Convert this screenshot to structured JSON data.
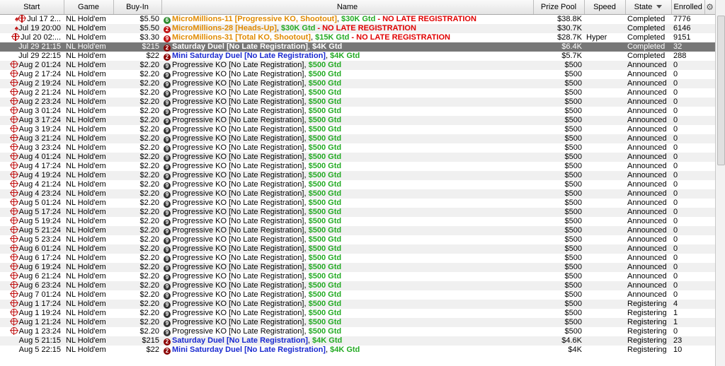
{
  "columns": {
    "start": "Start",
    "game": "Game",
    "buyin": "Buy-In",
    "name": "Name",
    "prize": "Prize Pool",
    "speed": "Speed",
    "state": "State",
    "enrolled": "Enrolled"
  },
  "rows": [
    {
      "icons": "spade-ko",
      "start": "Jul 17  2...",
      "game": "NL Hold'em",
      "buyin": "$5.50",
      "badge": "6",
      "badge_color": "green",
      "name": "MicroMillions-11 [Progressive KO, Shootout]",
      "name_style": "mm",
      "gtd": "$30K Gtd",
      "suffix": " - NO LATE REGISTRATION",
      "prize": "$38.8K",
      "speed": "",
      "state": "Completed",
      "enrolled": "7776"
    },
    {
      "icons": "spade",
      "start": "Jul 19  20:00",
      "game": "NL Hold'em",
      "buyin": "$5.50",
      "badge": "2",
      "badge_color": "red",
      "name": "MicroMillions-28 [Heads-Up]",
      "name_style": "mm",
      "gtd": "$30K Gtd",
      "suffix": " - NO LATE REGISTRATION",
      "prize": "$30.7K",
      "speed": "",
      "state": "Completed",
      "enrolled": "6146"
    },
    {
      "icons": "ko",
      "start": "Jul 20  02:...",
      "game": "NL Hold'em",
      "buyin": "$3.30",
      "badge": "9",
      "badge_color": "red",
      "name": "MicroMillions-31 [Total KO, Shootout]",
      "name_style": "mm",
      "gtd": "$15K Gtd",
      "suffix": " - NO LATE REGISTRATION",
      "prize": "$28.7K",
      "speed": "Hyper",
      "state": "Completed",
      "enrolled": "9151"
    },
    {
      "icons": "",
      "start": "Jul 29  21:15",
      "game": "NL Hold'em",
      "buyin": "$215",
      "badge": "2",
      "badge_color": "darkred",
      "name": "Saturday Duel [No Late Registration]",
      "name_style": "mini",
      "gtd": "$4K Gtd",
      "suffix": "",
      "prize": "$6.4K",
      "speed": "",
      "state": "Completed",
      "enrolled": "32",
      "selected": true
    },
    {
      "icons": "",
      "start": "Jul 29  22:15",
      "game": "NL Hold'em",
      "buyin": "$22",
      "badge": "2",
      "badge_color": "darkred",
      "name": "Mini Saturday Duel [No Late Registration]",
      "name_style": "mini",
      "gtd": "$4K Gtd",
      "suffix": "",
      "prize": "$5.7K",
      "speed": "",
      "state": "Completed",
      "enrolled": "288"
    },
    {
      "icons": "ko",
      "start": "Aug 2  01:24",
      "game": "NL Hold'em",
      "buyin": "$2.20",
      "badge": "9",
      "badge_color": "dark",
      "name": "Progressive KO [No Late Registration]",
      "name_style": "plain",
      "gtd": "$500 Gtd",
      "suffix": "",
      "prize": "$500",
      "speed": "",
      "state": "Announced",
      "enrolled": "0"
    },
    {
      "icons": "ko",
      "start": "Aug 2  17:24",
      "game": "NL Hold'em",
      "buyin": "$2.20",
      "badge": "9",
      "badge_color": "dark",
      "name": "Progressive KO [No Late Registration]",
      "name_style": "plain",
      "gtd": "$500 Gtd",
      "suffix": "",
      "prize": "$500",
      "speed": "",
      "state": "Announced",
      "enrolled": "0"
    },
    {
      "icons": "ko",
      "start": "Aug 2  19:24",
      "game": "NL Hold'em",
      "buyin": "$2.20",
      "badge": "9",
      "badge_color": "dark",
      "name": "Progressive KO [No Late Registration]",
      "name_style": "plain",
      "gtd": "$500 Gtd",
      "suffix": "",
      "prize": "$500",
      "speed": "",
      "state": "Announced",
      "enrolled": "0"
    },
    {
      "icons": "ko",
      "start": "Aug 2  21:24",
      "game": "NL Hold'em",
      "buyin": "$2.20",
      "badge": "9",
      "badge_color": "dark",
      "name": "Progressive KO [No Late Registration]",
      "name_style": "plain",
      "gtd": "$500 Gtd",
      "suffix": "",
      "prize": "$500",
      "speed": "",
      "state": "Announced",
      "enrolled": "0"
    },
    {
      "icons": "ko",
      "start": "Aug 2  23:24",
      "game": "NL Hold'em",
      "buyin": "$2.20",
      "badge": "9",
      "badge_color": "dark",
      "name": "Progressive KO [No Late Registration]",
      "name_style": "plain",
      "gtd": "$500 Gtd",
      "suffix": "",
      "prize": "$500",
      "speed": "",
      "state": "Announced",
      "enrolled": "0"
    },
    {
      "icons": "ko",
      "start": "Aug 3  01:24",
      "game": "NL Hold'em",
      "buyin": "$2.20",
      "badge": "9",
      "badge_color": "dark",
      "name": "Progressive KO [No Late Registration]",
      "name_style": "plain",
      "gtd": "$500 Gtd",
      "suffix": "",
      "prize": "$500",
      "speed": "",
      "state": "Announced",
      "enrolled": "0"
    },
    {
      "icons": "ko",
      "start": "Aug 3  17:24",
      "game": "NL Hold'em",
      "buyin": "$2.20",
      "badge": "9",
      "badge_color": "dark",
      "name": "Progressive KO [No Late Registration]",
      "name_style": "plain",
      "gtd": "$500 Gtd",
      "suffix": "",
      "prize": "$500",
      "speed": "",
      "state": "Announced",
      "enrolled": "0"
    },
    {
      "icons": "ko",
      "start": "Aug 3  19:24",
      "game": "NL Hold'em",
      "buyin": "$2.20",
      "badge": "9",
      "badge_color": "dark",
      "name": "Progressive KO [No Late Registration]",
      "name_style": "plain",
      "gtd": "$500 Gtd",
      "suffix": "",
      "prize": "$500",
      "speed": "",
      "state": "Announced",
      "enrolled": "0"
    },
    {
      "icons": "ko",
      "start": "Aug 3  21:24",
      "game": "NL Hold'em",
      "buyin": "$2.20",
      "badge": "9",
      "badge_color": "dark",
      "name": "Progressive KO [No Late Registration]",
      "name_style": "plain",
      "gtd": "$500 Gtd",
      "suffix": "",
      "prize": "$500",
      "speed": "",
      "state": "Announced",
      "enrolled": "0"
    },
    {
      "icons": "ko",
      "start": "Aug 3  23:24",
      "game": "NL Hold'em",
      "buyin": "$2.20",
      "badge": "9",
      "badge_color": "dark",
      "name": "Progressive KO [No Late Registration]",
      "name_style": "plain",
      "gtd": "$500 Gtd",
      "suffix": "",
      "prize": "$500",
      "speed": "",
      "state": "Announced",
      "enrolled": "0"
    },
    {
      "icons": "ko",
      "start": "Aug 4  01:24",
      "game": "NL Hold'em",
      "buyin": "$2.20",
      "badge": "9",
      "badge_color": "dark",
      "name": "Progressive KO [No Late Registration]",
      "name_style": "plain",
      "gtd": "$500 Gtd",
      "suffix": "",
      "prize": "$500",
      "speed": "",
      "state": "Announced",
      "enrolled": "0"
    },
    {
      "icons": "ko",
      "start": "Aug 4  17:24",
      "game": "NL Hold'em",
      "buyin": "$2.20",
      "badge": "9",
      "badge_color": "dark",
      "name": "Progressive KO [No Late Registration]",
      "name_style": "plain",
      "gtd": "$500 Gtd",
      "suffix": "",
      "prize": "$500",
      "speed": "",
      "state": "Announced",
      "enrolled": "0"
    },
    {
      "icons": "ko",
      "start": "Aug 4  19:24",
      "game": "NL Hold'em",
      "buyin": "$2.20",
      "badge": "9",
      "badge_color": "dark",
      "name": "Progressive KO [No Late Registration]",
      "name_style": "plain",
      "gtd": "$500 Gtd",
      "suffix": "",
      "prize": "$500",
      "speed": "",
      "state": "Announced",
      "enrolled": "0"
    },
    {
      "icons": "ko",
      "start": "Aug 4  21:24",
      "game": "NL Hold'em",
      "buyin": "$2.20",
      "badge": "9",
      "badge_color": "dark",
      "name": "Progressive KO [No Late Registration]",
      "name_style": "plain",
      "gtd": "$500 Gtd",
      "suffix": "",
      "prize": "$500",
      "speed": "",
      "state": "Announced",
      "enrolled": "0"
    },
    {
      "icons": "ko",
      "start": "Aug 4  23:24",
      "game": "NL Hold'em",
      "buyin": "$2.20",
      "badge": "9",
      "badge_color": "dark",
      "name": "Progressive KO [No Late Registration]",
      "name_style": "plain",
      "gtd": "$500 Gtd",
      "suffix": "",
      "prize": "$500",
      "speed": "",
      "state": "Announced",
      "enrolled": "0"
    },
    {
      "icons": "ko",
      "start": "Aug 5  01:24",
      "game": "NL Hold'em",
      "buyin": "$2.20",
      "badge": "9",
      "badge_color": "dark",
      "name": "Progressive KO [No Late Registration]",
      "name_style": "plain",
      "gtd": "$500 Gtd",
      "suffix": "",
      "prize": "$500",
      "speed": "",
      "state": "Announced",
      "enrolled": "0"
    },
    {
      "icons": "ko",
      "start": "Aug 5  17:24",
      "game": "NL Hold'em",
      "buyin": "$2.20",
      "badge": "9",
      "badge_color": "dark",
      "name": "Progressive KO [No Late Registration]",
      "name_style": "plain",
      "gtd": "$500 Gtd",
      "suffix": "",
      "prize": "$500",
      "speed": "",
      "state": "Announced",
      "enrolled": "0"
    },
    {
      "icons": "ko",
      "start": "Aug 5  19:24",
      "game": "NL Hold'em",
      "buyin": "$2.20",
      "badge": "9",
      "badge_color": "dark",
      "name": "Progressive KO [No Late Registration]",
      "name_style": "plain",
      "gtd": "$500 Gtd",
      "suffix": "",
      "prize": "$500",
      "speed": "",
      "state": "Announced",
      "enrolled": "0"
    },
    {
      "icons": "ko",
      "start": "Aug 5  21:24",
      "game": "NL Hold'em",
      "buyin": "$2.20",
      "badge": "9",
      "badge_color": "dark",
      "name": "Progressive KO [No Late Registration]",
      "name_style": "plain",
      "gtd": "$500 Gtd",
      "suffix": "",
      "prize": "$500",
      "speed": "",
      "state": "Announced",
      "enrolled": "0"
    },
    {
      "icons": "ko",
      "start": "Aug 5  23:24",
      "game": "NL Hold'em",
      "buyin": "$2.20",
      "badge": "9",
      "badge_color": "dark",
      "name": "Progressive KO [No Late Registration]",
      "name_style": "plain",
      "gtd": "$500 Gtd",
      "suffix": "",
      "prize": "$500",
      "speed": "",
      "state": "Announced",
      "enrolled": "0"
    },
    {
      "icons": "ko",
      "start": "Aug 6  01:24",
      "game": "NL Hold'em",
      "buyin": "$2.20",
      "badge": "9",
      "badge_color": "dark",
      "name": "Progressive KO [No Late Registration]",
      "name_style": "plain",
      "gtd": "$500 Gtd",
      "suffix": "",
      "prize": "$500",
      "speed": "",
      "state": "Announced",
      "enrolled": "0"
    },
    {
      "icons": "ko",
      "start": "Aug 6  17:24",
      "game": "NL Hold'em",
      "buyin": "$2.20",
      "badge": "9",
      "badge_color": "dark",
      "name": "Progressive KO [No Late Registration]",
      "name_style": "plain",
      "gtd": "$500 Gtd",
      "suffix": "",
      "prize": "$500",
      "speed": "",
      "state": "Announced",
      "enrolled": "0"
    },
    {
      "icons": "ko",
      "start": "Aug 6  19:24",
      "game": "NL Hold'em",
      "buyin": "$2.20",
      "badge": "9",
      "badge_color": "dark",
      "name": "Progressive KO [No Late Registration]",
      "name_style": "plain",
      "gtd": "$500 Gtd",
      "suffix": "",
      "prize": "$500",
      "speed": "",
      "state": "Announced",
      "enrolled": "0"
    },
    {
      "icons": "ko",
      "start": "Aug 6  21:24",
      "game": "NL Hold'em",
      "buyin": "$2.20",
      "badge": "9",
      "badge_color": "dark",
      "name": "Progressive KO [No Late Registration]",
      "name_style": "plain",
      "gtd": "$500 Gtd",
      "suffix": "",
      "prize": "$500",
      "speed": "",
      "state": "Announced",
      "enrolled": "0"
    },
    {
      "icons": "ko",
      "start": "Aug 6  23:24",
      "game": "NL Hold'em",
      "buyin": "$2.20",
      "badge": "9",
      "badge_color": "dark",
      "name": "Progressive KO [No Late Registration]",
      "name_style": "plain",
      "gtd": "$500 Gtd",
      "suffix": "",
      "prize": "$500",
      "speed": "",
      "state": "Announced",
      "enrolled": "0"
    },
    {
      "icons": "ko",
      "start": "Aug 7  01:24",
      "game": "NL Hold'em",
      "buyin": "$2.20",
      "badge": "9",
      "badge_color": "dark",
      "name": "Progressive KO [No Late Registration]",
      "name_style": "plain",
      "gtd": "$500 Gtd",
      "suffix": "",
      "prize": "$500",
      "speed": "",
      "state": "Announced",
      "enrolled": "0"
    },
    {
      "icons": "ko",
      "start": "Aug 1  17:24",
      "game": "NL Hold'em",
      "buyin": "$2.20",
      "badge": "9",
      "badge_color": "dark",
      "name": "Progressive KO [No Late Registration]",
      "name_style": "plain",
      "gtd": "$500 Gtd",
      "suffix": "",
      "prize": "$500",
      "speed": "",
      "state": "Registering",
      "enrolled": "4"
    },
    {
      "icons": "ko",
      "start": "Aug 1  19:24",
      "game": "NL Hold'em",
      "buyin": "$2.20",
      "badge": "9",
      "badge_color": "dark",
      "name": "Progressive KO [No Late Registration]",
      "name_style": "plain",
      "gtd": "$500 Gtd",
      "suffix": "",
      "prize": "$500",
      "speed": "",
      "state": "Registering",
      "enrolled": "1"
    },
    {
      "icons": "ko",
      "start": "Aug 1  21:24",
      "game": "NL Hold'em",
      "buyin": "$2.20",
      "badge": "9",
      "badge_color": "dark",
      "name": "Progressive KO [No Late Registration]",
      "name_style": "plain",
      "gtd": "$500 Gtd",
      "suffix": "",
      "prize": "$500",
      "speed": "",
      "state": "Registering",
      "enrolled": "1"
    },
    {
      "icons": "ko",
      "start": "Aug 1  23:24",
      "game": "NL Hold'em",
      "buyin": "$2.20",
      "badge": "9",
      "badge_color": "dark",
      "name": "Progressive KO [No Late Registration]",
      "name_style": "plain",
      "gtd": "$500 Gtd",
      "suffix": "",
      "prize": "$500",
      "speed": "",
      "state": "Registering",
      "enrolled": "0"
    },
    {
      "icons": "",
      "start": "Aug 5  21:15",
      "game": "NL Hold'em",
      "buyin": "$215",
      "badge": "2",
      "badge_color": "darkred",
      "name": "Saturday Duel [No Late Registration]",
      "name_style": "mini",
      "gtd": "$4K Gtd",
      "suffix": "",
      "prize": "$4.6K",
      "speed": "",
      "state": "Registering",
      "enrolled": "23"
    },
    {
      "icons": "",
      "start": "Aug 5  22:15",
      "game": "NL Hold'em",
      "buyin": "$22",
      "badge": "2",
      "badge_color": "darkred",
      "name": "Mini Saturday Duel [No Late Registration]",
      "name_style": "mini",
      "gtd": "$4K Gtd",
      "suffix": "",
      "prize": "$4K",
      "speed": "",
      "state": "Registering",
      "enrolled": "10"
    }
  ]
}
